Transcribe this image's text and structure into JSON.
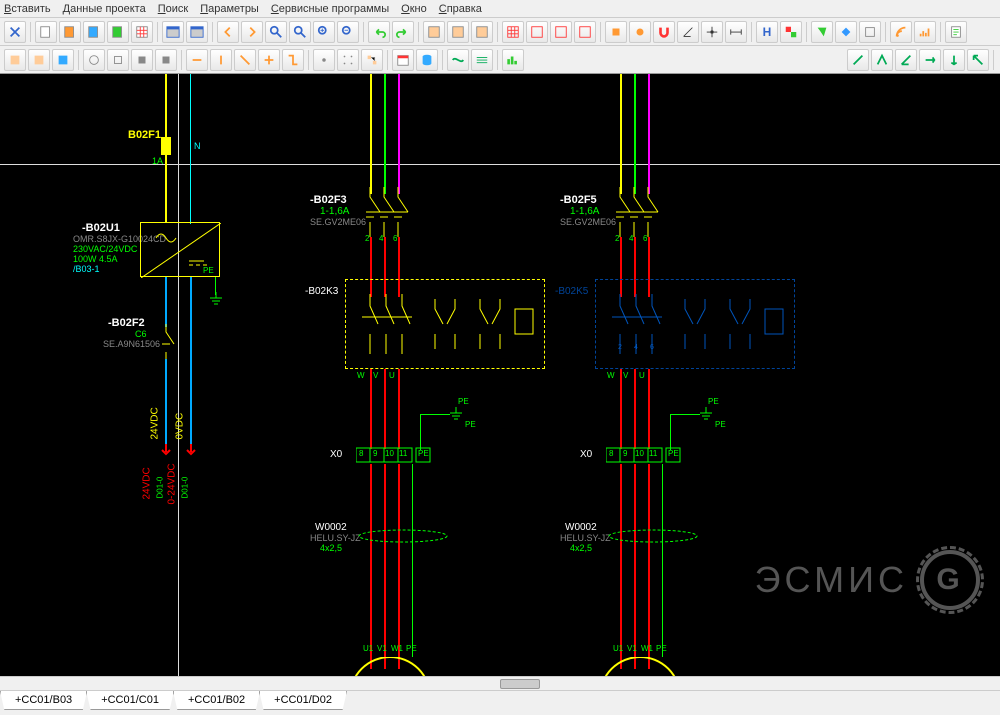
{
  "menu": {
    "items": [
      "Вставить",
      "Данные проекта",
      "Поиск",
      "Параметры",
      "Сервисные программы",
      "Окно",
      "Справка"
    ]
  },
  "tabs": [
    "+CC01/B03",
    "+CC01/C01",
    "+CC01/B02",
    "+CC01/D02"
  ],
  "watermark": "ЭСМИС",
  "components": {
    "fuse1": {
      "name": "B02F1",
      "sub": "1A",
      "n": "N"
    },
    "psu": {
      "name": "-B02U1",
      "p1": "OMR.S8JX-G10024CD",
      "p2": "230VAC/24VDC",
      "p3": "100W 4.5A",
      "ref": "/B03-1",
      "pe": "PE"
    },
    "cb2": {
      "name": "-B02F2",
      "p1": "C6",
      "p2": "SE.A9N61506"
    },
    "v24": "24VDC",
    "v0": "0VDC",
    "v24a": "24VDC",
    "v0a": "0-24VDC",
    "d1": "D01-0",
    "d2": "D01-0",
    "cb3": {
      "name": "-B02F3",
      "p1": "1-1,6A",
      "p2": "SE.GV2ME06"
    },
    "cb5": {
      "name": "-B02F5",
      "p1": "1-1,6A",
      "p2": "SE.GV2ME06"
    },
    "k3": {
      "name": "-B02K3"
    },
    "k5": {
      "name": "-B02K5"
    },
    "x0": "X0",
    "pe": "PE",
    "w2": {
      "name": "W0002",
      "p1": "HELU.SY-JZ",
      "p2": "4x2,5"
    },
    "w2b": {
      "name": "W0002",
      "p1": "HELU.SY-JZ",
      "p2": "4x2,5"
    },
    "term": {
      "t8": "8",
      "t9": "9",
      "t10": "10",
      "t11": "11",
      "tpe": "PE"
    },
    "motor_u": "U1",
    "motor_v": "V1",
    "motor_w": "W1",
    "motor_pe": "PE",
    "k_w": "W",
    "k_v": "V",
    "k_u": "U",
    "cb_nums": {
      "n2": "2",
      "n4": "4",
      "n6": "6"
    }
  }
}
